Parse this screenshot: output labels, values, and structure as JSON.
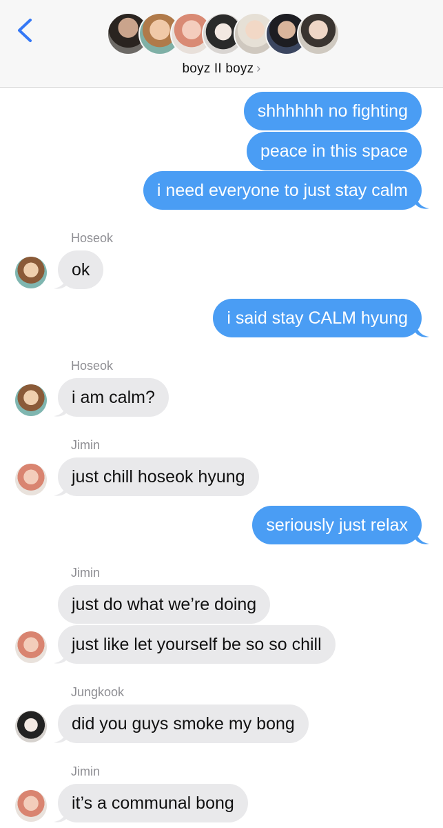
{
  "header": {
    "group_name": "boyz II boyz",
    "chevron": "›",
    "member_avatar_count": 7
  },
  "messages": [
    {
      "side": "out",
      "text": "shhhhhh no fighting"
    },
    {
      "side": "out",
      "text": "peace in this space"
    },
    {
      "side": "out",
      "text": "i need everyone to just stay calm"
    },
    {
      "side": "in",
      "sender": "Hoseok",
      "text": "ok"
    },
    {
      "side": "out",
      "text": "i said stay CALM hyung"
    },
    {
      "side": "in",
      "sender": "Hoseok",
      "text": "i am calm?"
    },
    {
      "side": "in",
      "sender": "Jimin",
      "text": "just chill hoseok hyung"
    },
    {
      "side": "out",
      "text": "seriously just relax"
    },
    {
      "side": "in",
      "sender": "Jimin",
      "text": "just do what we’re doing"
    },
    {
      "side": "in",
      "text": "just like let yourself be so so chill"
    },
    {
      "side": "in",
      "sender": "Jungkook",
      "text": "did you guys smoke my bong"
    },
    {
      "side": "in",
      "sender": "Jimin",
      "text": "it’s a communal bong"
    }
  ],
  "colors": {
    "outgoing_bubble": "#4a9df4",
    "incoming_bubble": "#e9e9eb",
    "accent": "#3478f6"
  }
}
